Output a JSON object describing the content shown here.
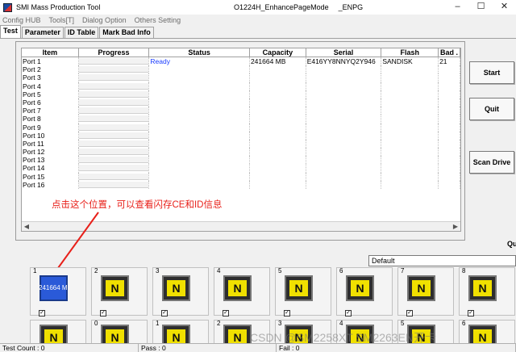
{
  "window": {
    "app_title": "SMI Mass Production Tool",
    "doc_title": "O1224H_EnhancePageMode",
    "doc_suffix": "_ENPG",
    "minimize_glyph": "–",
    "maximize_glyph": "☐",
    "close_glyph": "✕"
  },
  "menu": [
    "Config HUB",
    "Tools[T]",
    "Dialog Option",
    "Others Setting"
  ],
  "tabs": [
    "Test",
    "Parameter",
    "ID Table",
    "Mark Bad Info"
  ],
  "table": {
    "columns": [
      "Item",
      "Progress",
      "Status",
      "Capacity",
      "Serial",
      "Flash",
      "Bad ."
    ],
    "rows": [
      {
        "item": "Port 1",
        "status": "Ready",
        "capacity": "241664 MB",
        "serial": "E416YY8NNYQ2Y946",
        "flash": "SANDISK",
        "bad": "21"
      },
      {
        "item": "Port 2",
        "status": "",
        "capacity": "",
        "serial": "",
        "flash": "",
        "bad": ""
      },
      {
        "item": "Port 3",
        "status": "",
        "capacity": "",
        "serial": "",
        "flash": "",
        "bad": ""
      },
      {
        "item": "Port 4",
        "status": "",
        "capacity": "",
        "serial": "",
        "flash": "",
        "bad": ""
      },
      {
        "item": "Port 5",
        "status": "",
        "capacity": "",
        "serial": "",
        "flash": "",
        "bad": ""
      },
      {
        "item": "Port 6",
        "status": "",
        "capacity": "",
        "serial": "",
        "flash": "",
        "bad": ""
      },
      {
        "item": "Port 7",
        "status": "",
        "capacity": "",
        "serial": "",
        "flash": "",
        "bad": ""
      },
      {
        "item": "Port 8",
        "status": "",
        "capacity": "",
        "serial": "",
        "flash": "",
        "bad": ""
      },
      {
        "item": "Port 9",
        "status": "",
        "capacity": "",
        "serial": "",
        "flash": "",
        "bad": ""
      },
      {
        "item": "Port 10",
        "status": "",
        "capacity": "",
        "serial": "",
        "flash": "",
        "bad": ""
      },
      {
        "item": "Port 11",
        "status": "",
        "capacity": "",
        "serial": "",
        "flash": "",
        "bad": ""
      },
      {
        "item": "Port 12",
        "status": "",
        "capacity": "",
        "serial": "",
        "flash": "",
        "bad": ""
      },
      {
        "item": "Port 13",
        "status": "",
        "capacity": "",
        "serial": "",
        "flash": "",
        "bad": ""
      },
      {
        "item": "Port 14",
        "status": "",
        "capacity": "",
        "serial": "",
        "flash": "",
        "bad": ""
      },
      {
        "item": "Port 15",
        "status": "",
        "capacity": "",
        "serial": "",
        "flash": "",
        "bad": ""
      },
      {
        "item": "Port 16",
        "status": "",
        "capacity": "",
        "serial": "",
        "flash": "",
        "bad": ""
      }
    ]
  },
  "annotation": "点击这个位置，可以查看闪存CE和ID信息",
  "buttons": {
    "start": "Start",
    "quit": "Quit",
    "scan": "Scan Drive"
  },
  "qu_label": "Qu",
  "profile_select": "Default",
  "drives_row1": [
    {
      "num": "1",
      "label": "241664 M",
      "active": true
    },
    {
      "num": "2",
      "label": "N",
      "active": false
    },
    {
      "num": "3",
      "label": "N",
      "active": false
    },
    {
      "num": "4",
      "label": "N",
      "active": false
    },
    {
      "num": "5",
      "label": "N",
      "active": false
    },
    {
      "num": "6",
      "label": "N",
      "active": false
    },
    {
      "num": "7",
      "label": "N",
      "active": false
    },
    {
      "num": "8",
      "label": "N",
      "active": false
    }
  ],
  "drives_row2": [
    {
      "num": "",
      "label": "N"
    },
    {
      "num": "0",
      "label": "N"
    },
    {
      "num": "1",
      "label": "N"
    },
    {
      "num": "2",
      "label": "N"
    },
    {
      "num": "3",
      "label": "N"
    },
    {
      "num": "4",
      "label": "N"
    },
    {
      "num": "5",
      "label": "N"
    },
    {
      "num": "6",
      "label": "N"
    }
  ],
  "statusbar": {
    "test_count": "Test Count : 0",
    "pass": "Pass : 0",
    "fail": "Fail : 0"
  },
  "watermark": "CSDN @SM2258XT SM2263EN开卡"
}
